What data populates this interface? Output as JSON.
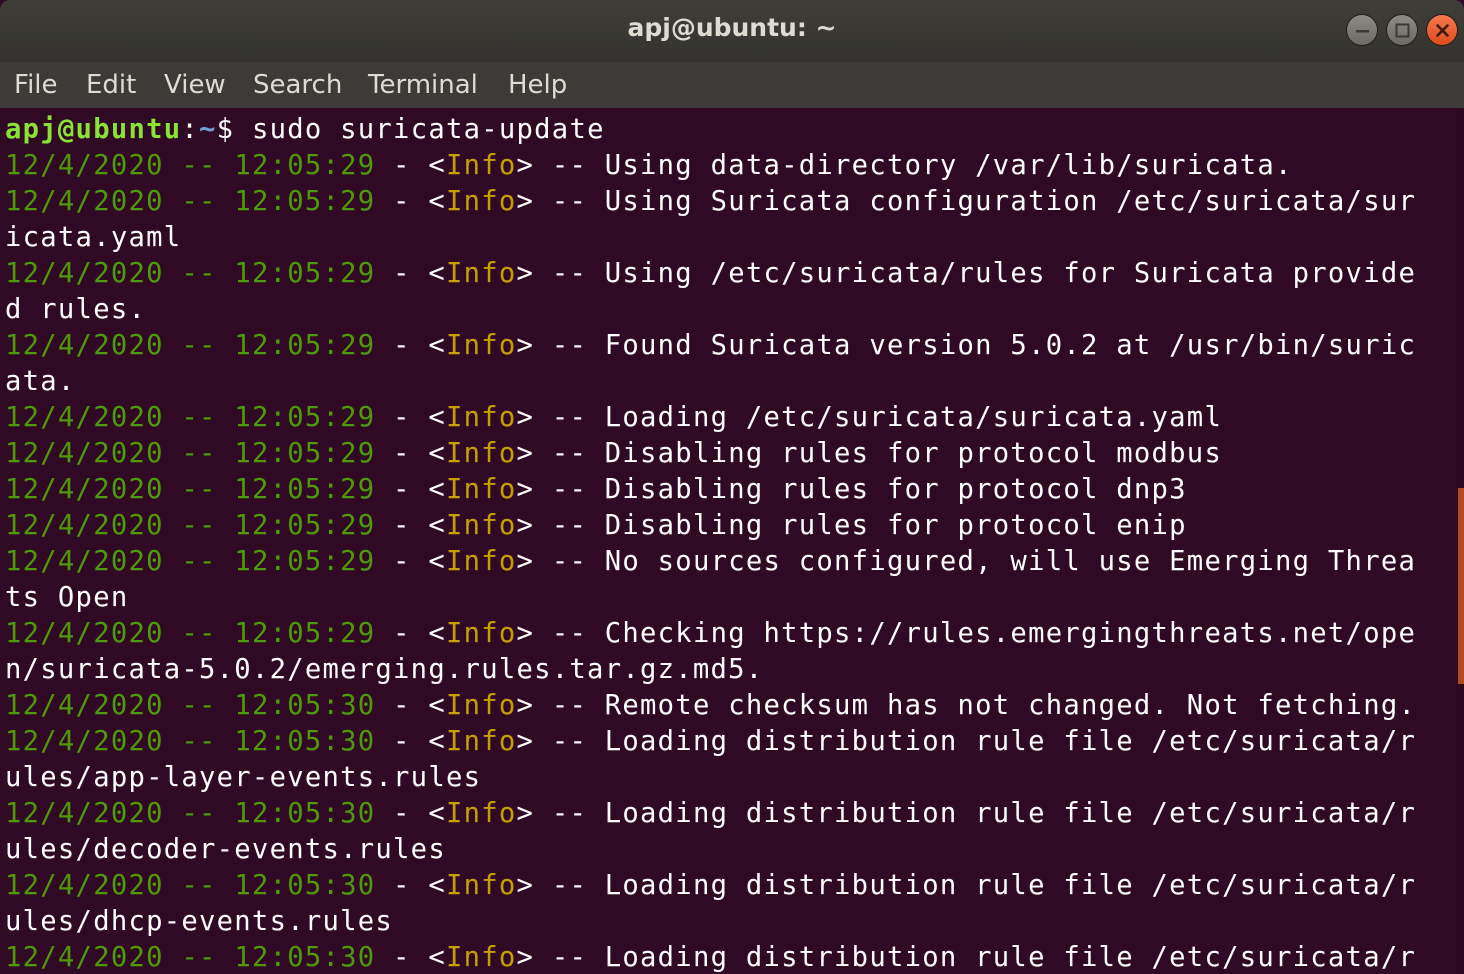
{
  "window": {
    "title": "apj@ubuntu: ~"
  },
  "menu": [
    "File",
    "Edit",
    "View",
    "Search",
    "Terminal",
    "Help"
  ],
  "prompt": {
    "user_host": "apj@ubuntu",
    "separator": ":",
    "path": "~",
    "symbol": "$",
    "command": " sudo suricata-update"
  },
  "log_lines": [
    {
      "date": "12/4/2020",
      "time": "12:05:29",
      "level": "Info",
      "msg": "Using data-directory /var/lib/suricata."
    },
    {
      "date": "12/4/2020",
      "time": "12:05:29",
      "level": "Info",
      "msg": "Using Suricata configuration /etc/suricata/sur",
      "cont": "icata.yaml"
    },
    {
      "date": "12/4/2020",
      "time": "12:05:29",
      "level": "Info",
      "msg": "Using /etc/suricata/rules for Suricata provide",
      "cont": "d rules."
    },
    {
      "date": "12/4/2020",
      "time": "12:05:29",
      "level": "Info",
      "msg": "Found Suricata version 5.0.2 at /usr/bin/suric",
      "cont": "ata."
    },
    {
      "date": "12/4/2020",
      "time": "12:05:29",
      "level": "Info",
      "msg": "Loading /etc/suricata/suricata.yaml"
    },
    {
      "date": "12/4/2020",
      "time": "12:05:29",
      "level": "Info",
      "msg": "Disabling rules for protocol modbus"
    },
    {
      "date": "12/4/2020",
      "time": "12:05:29",
      "level": "Info",
      "msg": "Disabling rules for protocol dnp3"
    },
    {
      "date": "12/4/2020",
      "time": "12:05:29",
      "level": "Info",
      "msg": "Disabling rules for protocol enip"
    },
    {
      "date": "12/4/2020",
      "time": "12:05:29",
      "level": "Info",
      "msg": "No sources configured, will use Emerging Threa",
      "cont": "ts Open"
    },
    {
      "date": "12/4/2020",
      "time": "12:05:29",
      "level": "Info",
      "msg": "Checking https://rules.emergingthreats.net/ope",
      "cont": "n/suricata-5.0.2/emerging.rules.tar.gz.md5."
    },
    {
      "date": "12/4/2020",
      "time": "12:05:30",
      "level": "Info",
      "msg": "Remote checksum has not changed. Not fetching."
    },
    {
      "date": "12/4/2020",
      "time": "12:05:30",
      "level": "Info",
      "msg": "Loading distribution rule file /etc/suricata/r",
      "cont": "ules/app-layer-events.rules"
    },
    {
      "date": "12/4/2020",
      "time": "12:05:30",
      "level": "Info",
      "msg": "Loading distribution rule file /etc/suricata/r",
      "cont": "ules/decoder-events.rules"
    },
    {
      "date": "12/4/2020",
      "time": "12:05:30",
      "level": "Info",
      "msg": "Loading distribution rule file /etc/suricata/r",
      "cont": "ules/dhcp-events.rules"
    },
    {
      "date": "12/4/2020",
      "time": "12:05:30",
      "level": "Info",
      "msg": "Loading distribution rule file /etc/suricata/r"
    }
  ],
  "colors": {
    "background": "#300a24",
    "timestamp": "#4e9a06",
    "level": "#c4a000",
    "prompt_user": "#8ae234",
    "prompt_path": "#729fcf",
    "close_button": "#e9541f"
  },
  "icons": {
    "minimize": "minimize-icon",
    "maximize": "maximize-icon",
    "close": "close-icon"
  }
}
